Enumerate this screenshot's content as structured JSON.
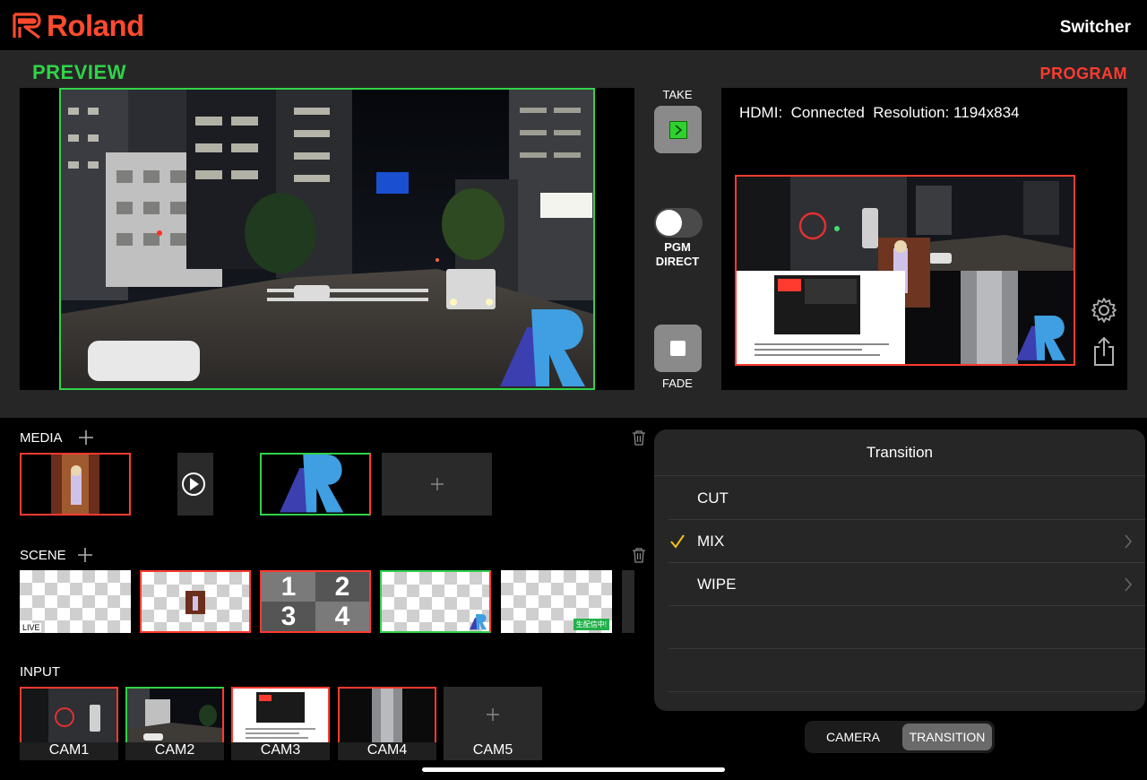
{
  "header": {
    "brand": "Roland",
    "title": "Switcher",
    "brand_color": "#ff4a2e"
  },
  "preview": {
    "label": "PREVIEW",
    "color": "#31d24a"
  },
  "program": {
    "label": "PROGRAM",
    "color": "#ff3b30",
    "hdmi_status": "HDMI:  Connected  Resolution: 1194x834"
  },
  "controls": {
    "take_label": "TAKE",
    "pgm_direct_line1": "PGM",
    "pgm_direct_line2": "DIRECT",
    "fade_label": "FADE"
  },
  "media": {
    "label": "MEDIA"
  },
  "scene": {
    "label": "SCENE",
    "live_badge": "LIVE",
    "quad_numbers": [
      "1",
      "2",
      "3",
      "4"
    ],
    "streaming_badge": "生配信中!"
  },
  "input": {
    "label": "INPUT",
    "cameras": [
      "CAM1",
      "CAM2",
      "CAM3",
      "CAM4",
      "CAM5"
    ]
  },
  "transition": {
    "title": "Transition",
    "options": [
      {
        "label": "CUT",
        "selected": false,
        "has_submenu": false
      },
      {
        "label": "MIX",
        "selected": true,
        "has_submenu": true
      },
      {
        "label": "WIPE",
        "selected": false,
        "has_submenu": true
      }
    ]
  },
  "tabs": {
    "camera": "CAMERA",
    "transition": "TRANSITION",
    "active": "TRANSITION"
  },
  "icons": {
    "add": "plus-icon",
    "delete": "trash-icon",
    "settings": "gear-icon",
    "share": "share-icon",
    "check": "checkmark-icon",
    "chevron": "chevron-right-icon"
  }
}
